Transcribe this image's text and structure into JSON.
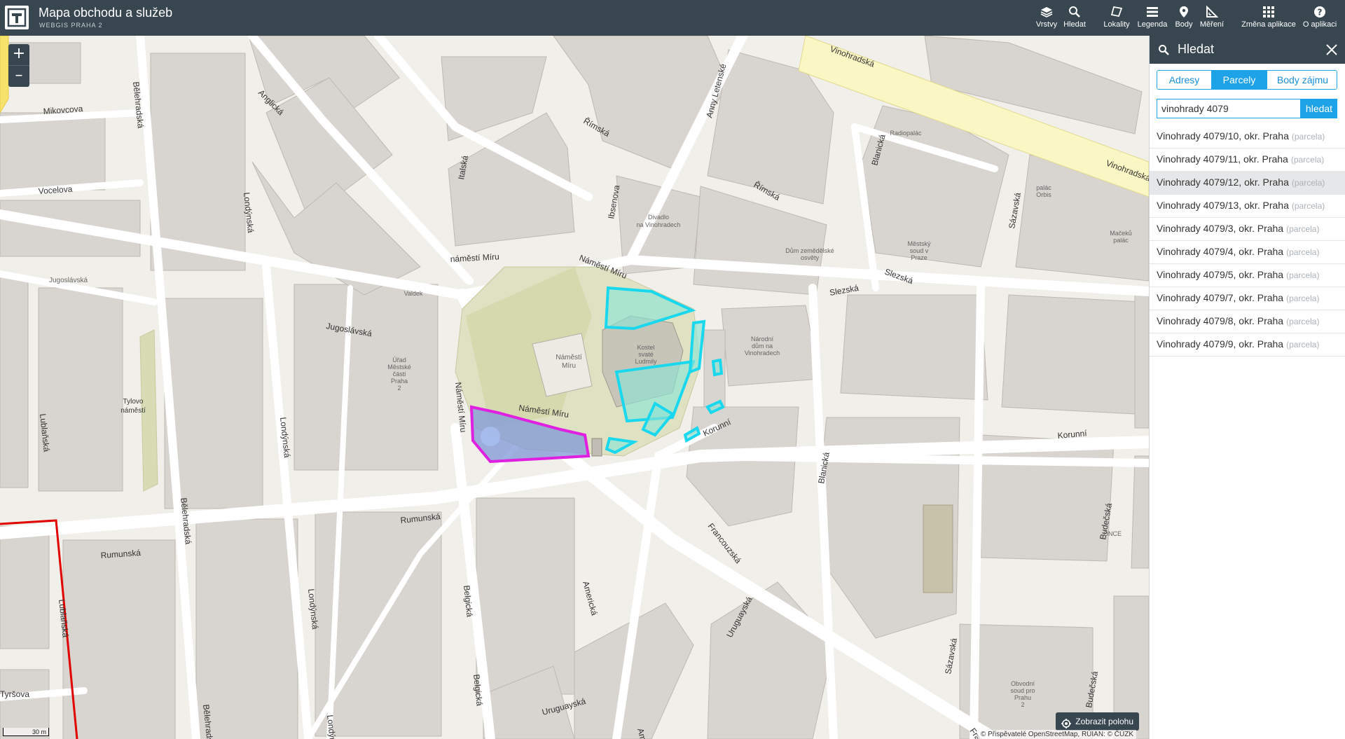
{
  "header": {
    "title": "Mapa obchodu a služeb",
    "subtitle": "WEBGIS PRAHA 2",
    "tools": [
      {
        "label": "Vrstvy",
        "icon": "layers-icon"
      },
      {
        "label": "Hledat",
        "icon": "search-icon"
      },
      {
        "label": "Lokality",
        "icon": "polygon-icon"
      },
      {
        "label": "Legenda",
        "icon": "list-icon"
      },
      {
        "label": "Body",
        "icon": "pin-icon"
      },
      {
        "label": "Měření",
        "icon": "ruler-icon"
      },
      {
        "label": "Změna aplikace",
        "icon": "grid-icon"
      },
      {
        "label": "O aplikaci",
        "icon": "help-icon"
      }
    ]
  },
  "map": {
    "zoom_in": "+",
    "zoom_out": "–",
    "scale_label": "30 m",
    "locate_button": "Zobrazit polohu",
    "attribution": "© Přispěvatelé OpenStreetMap, RÚIAN: © ČÚZK",
    "street_labels": {
      "mikovcova": "Mikovcova",
      "belehradska": "Bělehradská",
      "vocelova": "Vocelova",
      "anglicka": "Anglická",
      "italska": "Italská",
      "rimska": "Římská",
      "londynska": "Londýnská",
      "jugoslavska": "Jugoslávská",
      "namesti_miru": "náměstí Míru",
      "Namesti_miru": "Náměstí Míru",
      "rumunska": "Rumunská",
      "lublanska": "Lublaňská",
      "tyrsova": "Tyršova",
      "belgicka": "Belgická",
      "americka": "Americká",
      "uruguayska": "Uruguayská",
      "francouzska": "Francouzská",
      "korunni": "Korunní",
      "blanicka": "Blanická",
      "slezska": "Slezská",
      "sazavska": "Sázavská",
      "budecska": "Budečská",
      "vinohradska": "Vinohradská",
      "ibsenova": "Ibsenova",
      "anny_letenske": "Anny Letenské",
      "tylovo": "Tylovo",
      "namesti": "náměstí",
      "fra": "Fra"
    },
    "poi_labels": {
      "divadlo_1": "Divadlo",
      "divadlo_2": "na Vinohradech",
      "radiopalac": "Radiopalác",
      "valdek": "Valdek",
      "urad_1": "Úřad",
      "urad_2": "Městské",
      "urad_3": "části",
      "urad_4": "Praha",
      "urad_5": "2",
      "nm_1": "Náměstí",
      "nm_2": "Míru",
      "kostel_1": "Kostel",
      "kostel_2": "svaté",
      "kostel_3": "Ludmily",
      "narodni_1": "Národní",
      "narodni_2": "dům na",
      "narodni_3": "Vinohradech",
      "domu_1": "Dům zemědělské",
      "domu_2": "osvěty",
      "mestsky_1": "Městský",
      "mestsky_2": "soud v",
      "mestsky_3": "Praze",
      "orbis_1": "palác",
      "orbis_2": "Orbis",
      "macek_1": "Mačeků",
      "macek_2": "palác",
      "obvodni_1": "Obvodní",
      "obvodni_2": "soud pro",
      "obvodni_3": "Prahu",
      "obvodni_4": "2",
      "once": "ONCE",
      "jugoslavska_sq": "Jugoslávská"
    },
    "colors": {
      "selection_primary": "#e020e0",
      "selection_secondary": "#19d8ee",
      "boundary": "#e00000",
      "buildings": "#d8d4cf",
      "park": "#d7dcb5"
    }
  },
  "panel": {
    "title": "Hledat",
    "tabs": [
      {
        "label": "Adresy",
        "active": false
      },
      {
        "label": "Parcely",
        "active": true
      },
      {
        "label": "Body zájmu",
        "active": false
      }
    ],
    "search_value": "vinohrady 4079",
    "search_button": "hledat",
    "results": [
      {
        "name": "Vinohrady 4079/10, okr. Praha",
        "type": "(parcela)"
      },
      {
        "name": "Vinohrady 4079/11, okr. Praha",
        "type": "(parcela)"
      },
      {
        "name": "Vinohrady 4079/12, okr. Praha",
        "type": "(parcela)"
      },
      {
        "name": "Vinohrady 4079/13, okr. Praha",
        "type": "(parcela)"
      },
      {
        "name": "Vinohrady 4079/3, okr. Praha",
        "type": "(parcela)"
      },
      {
        "name": "Vinohrady 4079/4, okr. Praha",
        "type": "(parcela)"
      },
      {
        "name": "Vinohrady 4079/5, okr. Praha",
        "type": "(parcela)"
      },
      {
        "name": "Vinohrady 4079/7, okr. Praha",
        "type": "(parcela)"
      },
      {
        "name": "Vinohrady 4079/8, okr. Praha",
        "type": "(parcela)"
      },
      {
        "name": "Vinohrady 4079/9, okr. Praha",
        "type": "(parcela)"
      }
    ]
  }
}
